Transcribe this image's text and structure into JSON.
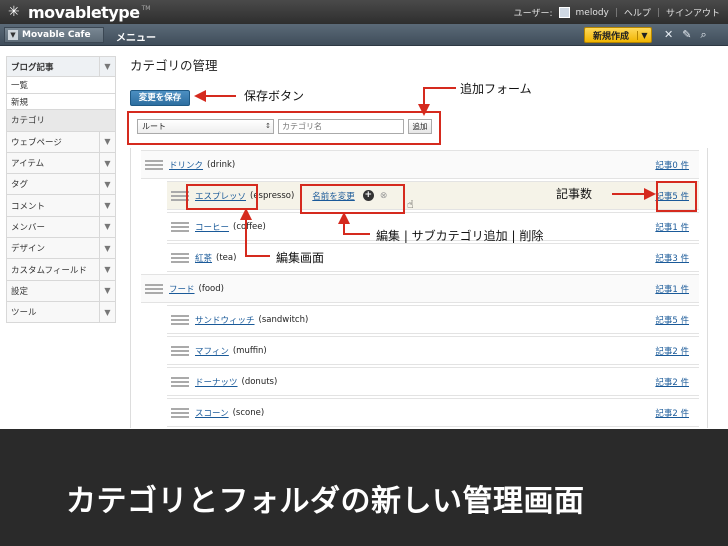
{
  "topbar": {
    "logo": "movabletype",
    "user_label": "ユーザー:",
    "username": "melody",
    "help": "ヘルプ",
    "signout": "サインアウト"
  },
  "blogbar": {
    "blog_name": "Movable Cafe",
    "menu_title": "メニュー",
    "new_button": "新規作成"
  },
  "sidebar": {
    "items": [
      {
        "label": "ブログ記事",
        "type": "head"
      },
      {
        "label": "一覧",
        "type": "sub"
      },
      {
        "label": "新規",
        "type": "sub"
      },
      {
        "label": "カテゴリ",
        "type": "active"
      },
      {
        "label": "ウェブページ",
        "type": "item"
      },
      {
        "label": "アイテム",
        "type": "item"
      },
      {
        "label": "タグ",
        "type": "item"
      },
      {
        "label": "コメント",
        "type": "item"
      },
      {
        "label": "メンバー",
        "type": "item"
      },
      {
        "label": "デザイン",
        "type": "item"
      },
      {
        "label": "カスタムフィールド",
        "type": "item"
      },
      {
        "label": "設定",
        "type": "item"
      },
      {
        "label": "ツール",
        "type": "item"
      }
    ]
  },
  "main": {
    "title": "カテゴリの管理",
    "save_button": "変更を保存",
    "add_form": {
      "parent_select": "ルート",
      "name_placeholder": "カテゴリ名",
      "add_button": "追加"
    },
    "rename_link": "名前を変更",
    "categories": [
      {
        "name": "ドリンク",
        "basename": "(drink)",
        "count": "記事0 件",
        "level": 0
      },
      {
        "name": "エスプレッソ",
        "basename": "(espresso)",
        "count": "記事5 件",
        "level": 1,
        "highlight": true
      },
      {
        "name": "コーヒー",
        "basename": "(coffee)",
        "count": "記事1 件",
        "level": 1
      },
      {
        "name": "紅茶",
        "basename": "(tea)",
        "count": "記事3 件",
        "level": 1
      },
      {
        "name": "フード",
        "basename": "(food)",
        "count": "記事1 件",
        "level": 0
      },
      {
        "name": "サンドウィッチ",
        "basename": "(sandwitch)",
        "count": "記事5 件",
        "level": 1
      },
      {
        "name": "マフィン",
        "basename": "(muffin)",
        "count": "記事2 件",
        "level": 1
      },
      {
        "name": "ドーナッツ",
        "basename": "(donuts)",
        "count": "記事2 件",
        "level": 1
      },
      {
        "name": "スコーン",
        "basename": "(scone)",
        "count": "記事2 件",
        "level": 1
      }
    ]
  },
  "annotations": {
    "save_button": "保存ボタン",
    "add_form": "追加フォーム",
    "post_count": "記事数",
    "actions": "編集 | サブカテゴリ追加 | 削除",
    "edit_screen": "編集画面",
    "color": "#d52a1e"
  },
  "caption": "カテゴリとフォルダの新しい管理画面"
}
